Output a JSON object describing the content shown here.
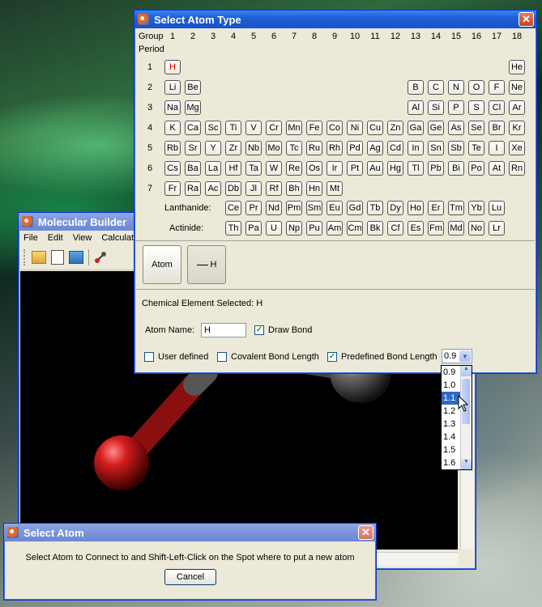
{
  "builder": {
    "title": "Molecular Builder",
    "menu": [
      "File",
      "Edit",
      "View",
      "Calculate"
    ]
  },
  "atomType": {
    "title": "Select Atom Type",
    "group_label": "Group",
    "period_label": "Period",
    "groups": [
      "1",
      "2",
      "3",
      "4",
      "5",
      "6",
      "7",
      "8",
      "9",
      "10",
      "11",
      "12",
      "13",
      "14",
      "15",
      "16",
      "17",
      "18"
    ],
    "periods": [
      "1",
      "2",
      "3",
      "4",
      "5",
      "6",
      "7"
    ],
    "rows": [
      [
        "H",
        "",
        "",
        "",
        "",
        "",
        "",
        "",
        "",
        "",
        "",
        "",
        "",
        "",
        "",
        "",
        "",
        "He"
      ],
      [
        "Li",
        "Be",
        "",
        "",
        "",
        "",
        "",
        "",
        "",
        "",
        "",
        "",
        "B",
        "C",
        "N",
        "O",
        "F",
        "Ne"
      ],
      [
        "Na",
        "Mg",
        "",
        "",
        "",
        "",
        "",
        "",
        "",
        "",
        "",
        "",
        "Al",
        "Si",
        "P",
        "S",
        "Cl",
        "Ar"
      ],
      [
        "K",
        "Ca",
        "Sc",
        "Ti",
        "V",
        "Cr",
        "Mn",
        "Fe",
        "Co",
        "Ni",
        "Cu",
        "Zn",
        "Ga",
        "Ge",
        "As",
        "Se",
        "Br",
        "Kr"
      ],
      [
        "Rb",
        "Sr",
        "Y",
        "Zr",
        "Nb",
        "Mo",
        "Tc",
        "Ru",
        "Rh",
        "Pd",
        "Ag",
        "Cd",
        "In",
        "Sn",
        "Sb",
        "Te",
        "I",
        "Xe"
      ],
      [
        "Cs",
        "Ba",
        "La",
        "Hf",
        "Ta",
        "W",
        "Re",
        "Os",
        "Ir",
        "Pt",
        "Au",
        "Hg",
        "Tl",
        "Pb",
        "Bi",
        "Po",
        "At",
        "Rn"
      ],
      [
        "Fr",
        "Ra",
        "Ac",
        "Db",
        "Jl",
        "Rf",
        "Bh",
        "Hn",
        "Mt",
        "",
        "",
        "",
        "",
        "",
        "",
        "",
        "",
        ""
      ]
    ],
    "lanthanide_label": "Lanthanide:",
    "actinide_label": "Actinide:",
    "lanthanides": [
      "Ce",
      "Pr",
      "Nd",
      "Pm",
      "Sm",
      "Eu",
      "Gd",
      "Tb",
      "Dy",
      "Ho",
      "Er",
      "Tm",
      "Yb",
      "Lu"
    ],
    "actinides": [
      "Th",
      "Pa",
      "U",
      "Np",
      "Pu",
      "Am",
      "Cm",
      "Bk",
      "Cf",
      "Es",
      "Fm",
      "Md",
      "No",
      "Lr"
    ],
    "selected_element": "H",
    "atom_button": "Atom",
    "bond_button": "H",
    "element_selected_text": "Chemical Element Selected: H",
    "atom_name_label": "Atom Name:",
    "atom_name_value": "H",
    "draw_bond_label": "Draw Bond",
    "draw_bond_checked": true,
    "user_defined_label": "User defined",
    "user_defined_checked": false,
    "covalent_label": "Covalent Bond Length",
    "covalent_checked": false,
    "predefined_label": "Predefined Bond Length",
    "predefined_checked": true,
    "bond_length_value": "0.9",
    "bond_length_options": [
      "0.9",
      "1.0",
      "1.1",
      "1.2",
      "1.3",
      "1.4",
      "1.5",
      "1.6"
    ],
    "bond_length_highlight": "1.1"
  },
  "selectAtom": {
    "title": "Select Atom",
    "message": "Select Atom to Connect to and Shift-Left-Click on the Spot where to put a new atom",
    "cancel": "Cancel"
  }
}
